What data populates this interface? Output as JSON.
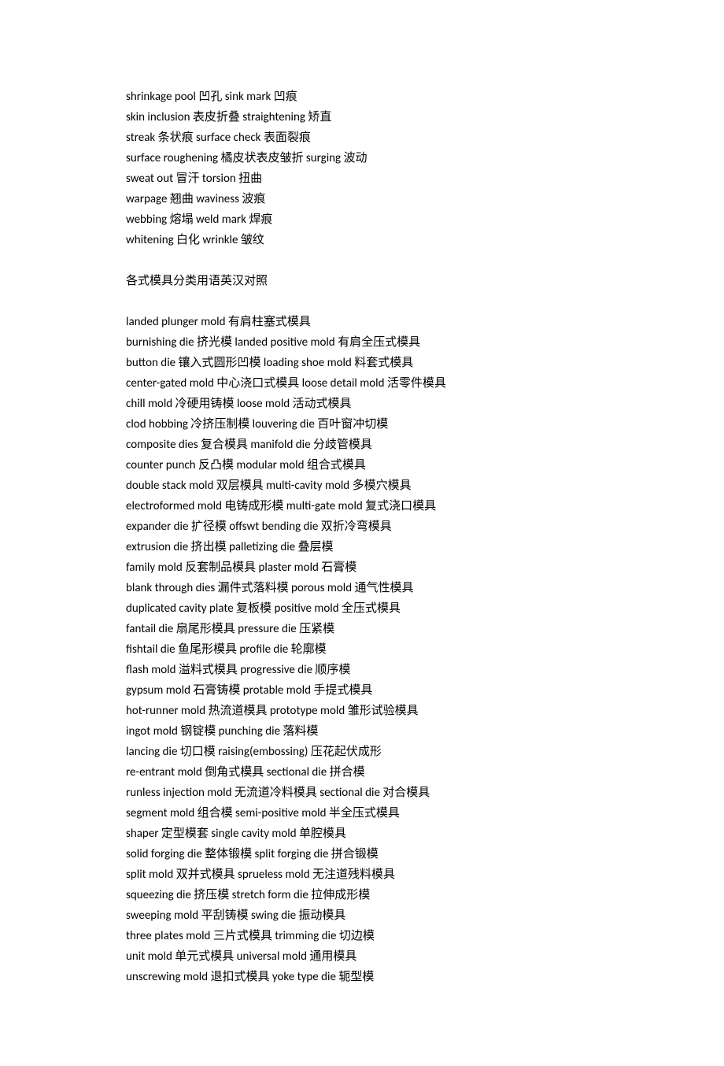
{
  "section1": [
    "shrinkage pool  凹孔  sink mark  凹痕",
    "skin inclusion  表皮折叠  straightening  矫直",
    "streak  条状痕  surface check  表面裂痕",
    "surface roughening  橘皮状表皮皱折  surging  波动",
    "sweat out  冒汗  torsion  扭曲",
    "warpage  翘曲  waviness  波痕",
    "webbing  熔塌  weld mark  焊痕",
    "whitening  白化  wrinkle  皱纹"
  ],
  "section2_heading": "各式模具分类用语英汉对照",
  "section2": [
    "landed plunger mold  有肩柱塞式模具",
    "burnishing die  挤光模  landed positive mold  有肩全压式模具",
    "button die  镶入式圆形凹模  loading shoe mold  料套式模具",
    "center-gated mold  中心浇口式模具  loose detail mold  活零件模具",
    "chill mold  冷硬用铸模  loose mold  活动式模具",
    "clod hobbing  冷挤压制模  louvering die  百叶窗冲切模",
    "composite dies  复合模具  manifold die  分歧管模具",
    "counter punch  反凸模  modular mold  组合式模具",
    "double stack mold  双层模具  multi-cavity mold  多模穴模具",
    "electroformed mold  电铸成形模  multi-gate mold  复式浇口模具",
    "expander die  扩径模  offswt bending die  双折冷弯模具",
    "extrusion die  挤出模  palletizing die  叠层模",
    "family mold  反套制品模具  plaster mold  石膏模",
    "blank through dies  漏件式落料模  porous mold  通气性模具",
    "duplicated cavity plate  复板模  positive mold  全压式模具",
    "fantail die  扇尾形模具  pressure die  压紧模",
    "fishtail die  鱼尾形模具  profile die  轮廓模",
    "flash mold  溢料式模具  progressive die  顺序模",
    "gypsum mold  石膏铸模  protable mold  手提式模具",
    "hot-runner mold  热流道模具  prototype mold  雏形试验模具",
    "ingot mold  钢锭模  punching die  落料模",
    "lancing die  切口模  raising(embossing)  压花起伏成形",
    "re-entrant mold  倒角式模具  sectional die  拼合模",
    "runless injection mold  无流道冷料模具  sectional die  对合模具",
    "segment mold  组合模  semi-positive mold  半全压式模具",
    "shaper  定型模套  single cavity mold  单腔模具",
    "solid forging die  整体锻模  split forging die  拼合锻模",
    "split mold  双并式模具  sprueless mold  无注道残料模具",
    "squeezing die  挤压模  stretch form die  拉伸成形模",
    "sweeping mold  平刮铸模  swing die  振动模具",
    "three plates mold  三片式模具  trimming die  切边模",
    "unit mold  单元式模具  universal mold  通用模具",
    "unscrewing mold  退扣式模具  yoke type die  轭型模"
  ]
}
